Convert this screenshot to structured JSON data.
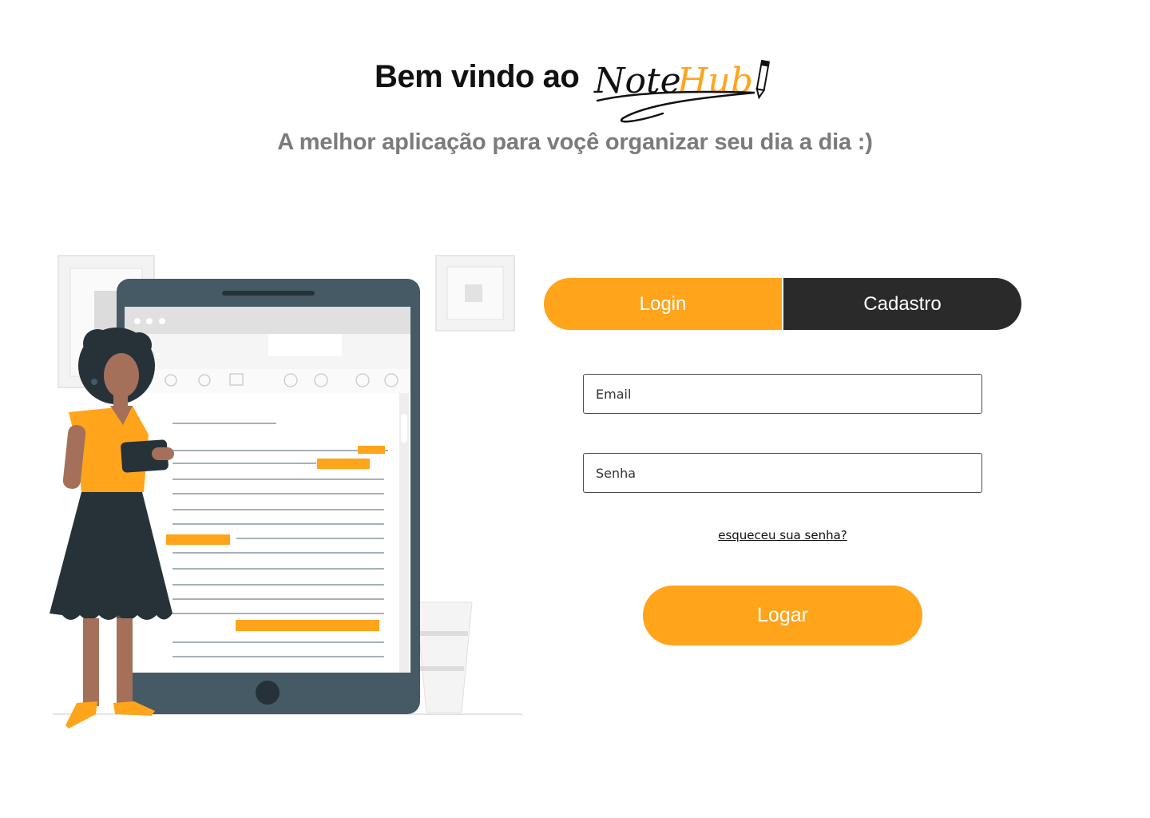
{
  "header": {
    "welcome": "Bem vindo ao",
    "logo_part1": "Note",
    "logo_part2": "Hub",
    "subtitle": "A melhor aplicação para voçê organizar seu dia a dia :)"
  },
  "tabs": {
    "login": "Login",
    "signup": "Cadastro"
  },
  "form": {
    "email_placeholder": "Email",
    "password_placeholder": "Senha",
    "forgot_link": "esqueceu sua senha?",
    "submit": "Logar"
  },
  "colors": {
    "accent": "#FFA41B",
    "dark": "#2a2a2a",
    "subtitle": "#7b7b7b",
    "tablet": "#455a64"
  },
  "illustration": "woman holding tablet next to large tablet showing document"
}
